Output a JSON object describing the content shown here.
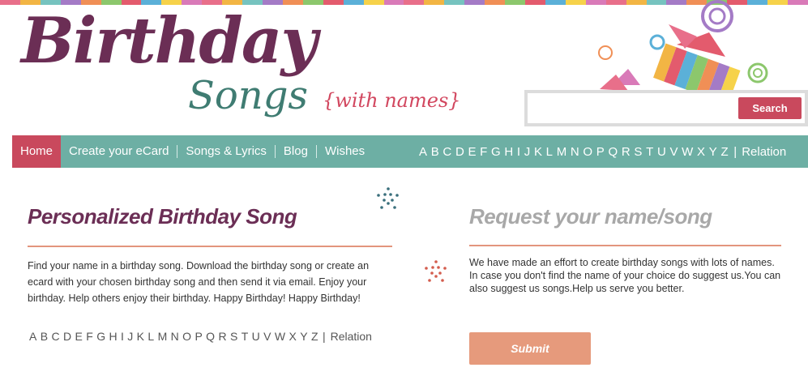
{
  "logo": {
    "main": "Birthday",
    "songs": "Songs",
    "sub": "{with names}"
  },
  "search": {
    "placeholder": "",
    "button_label": "Search"
  },
  "nav": {
    "items": [
      {
        "label": "Home"
      },
      {
        "label": "Create your eCard"
      },
      {
        "label": "Songs & Lyrics"
      },
      {
        "label": "Blog"
      },
      {
        "label": "Wishes"
      }
    ],
    "alphabet": [
      "A",
      "B",
      "C",
      "D",
      "E",
      "F",
      "G",
      "H",
      "I",
      "J",
      "K",
      "L",
      "M",
      "N",
      "O",
      "P",
      "Q",
      "R",
      "S",
      "T",
      "U",
      "V",
      "W",
      "X",
      "Y",
      "Z"
    ],
    "separator": "|",
    "relation_label": "Relation"
  },
  "left": {
    "title": "Personalized Birthday Song",
    "text": "Find your name in a birthday song. Download the birthday song or create an ecard with your chosen birthday song and then send it via email. Enjoy your birthday. Help others enjoy their birthday. Happy Birthday! Happy Birthday!",
    "alphabet": [
      "A",
      "B",
      "C",
      "D",
      "E",
      "F",
      "G",
      "H",
      "I",
      "J",
      "K",
      "L",
      "M",
      "N",
      "O",
      "P",
      "Q",
      "R",
      "S",
      "T",
      "U",
      "V",
      "W",
      "X",
      "Y",
      "Z"
    ],
    "separator": "|",
    "relation_label": "Relation"
  },
  "right": {
    "title": "Request your name/song",
    "text": "We have made an effort to create birthday songs with lots of names. In case you don't find the name of your choice do suggest us.You can also suggest us songs.Help us serve you better.",
    "submit_label": "Submit"
  },
  "colors": {
    "brand_plum": "#6b2e55",
    "brand_teal": "#6dafa4",
    "accent_red": "#c9495d",
    "accent_salmon": "#e69a7c",
    "stripe": [
      "#e86f8a",
      "#f2b544",
      "#76c3bf",
      "#a47bc6",
      "#f08f56",
      "#8cc76c",
      "#e35b6d",
      "#5bb0d8",
      "#f6d24a",
      "#d97ab8"
    ]
  }
}
